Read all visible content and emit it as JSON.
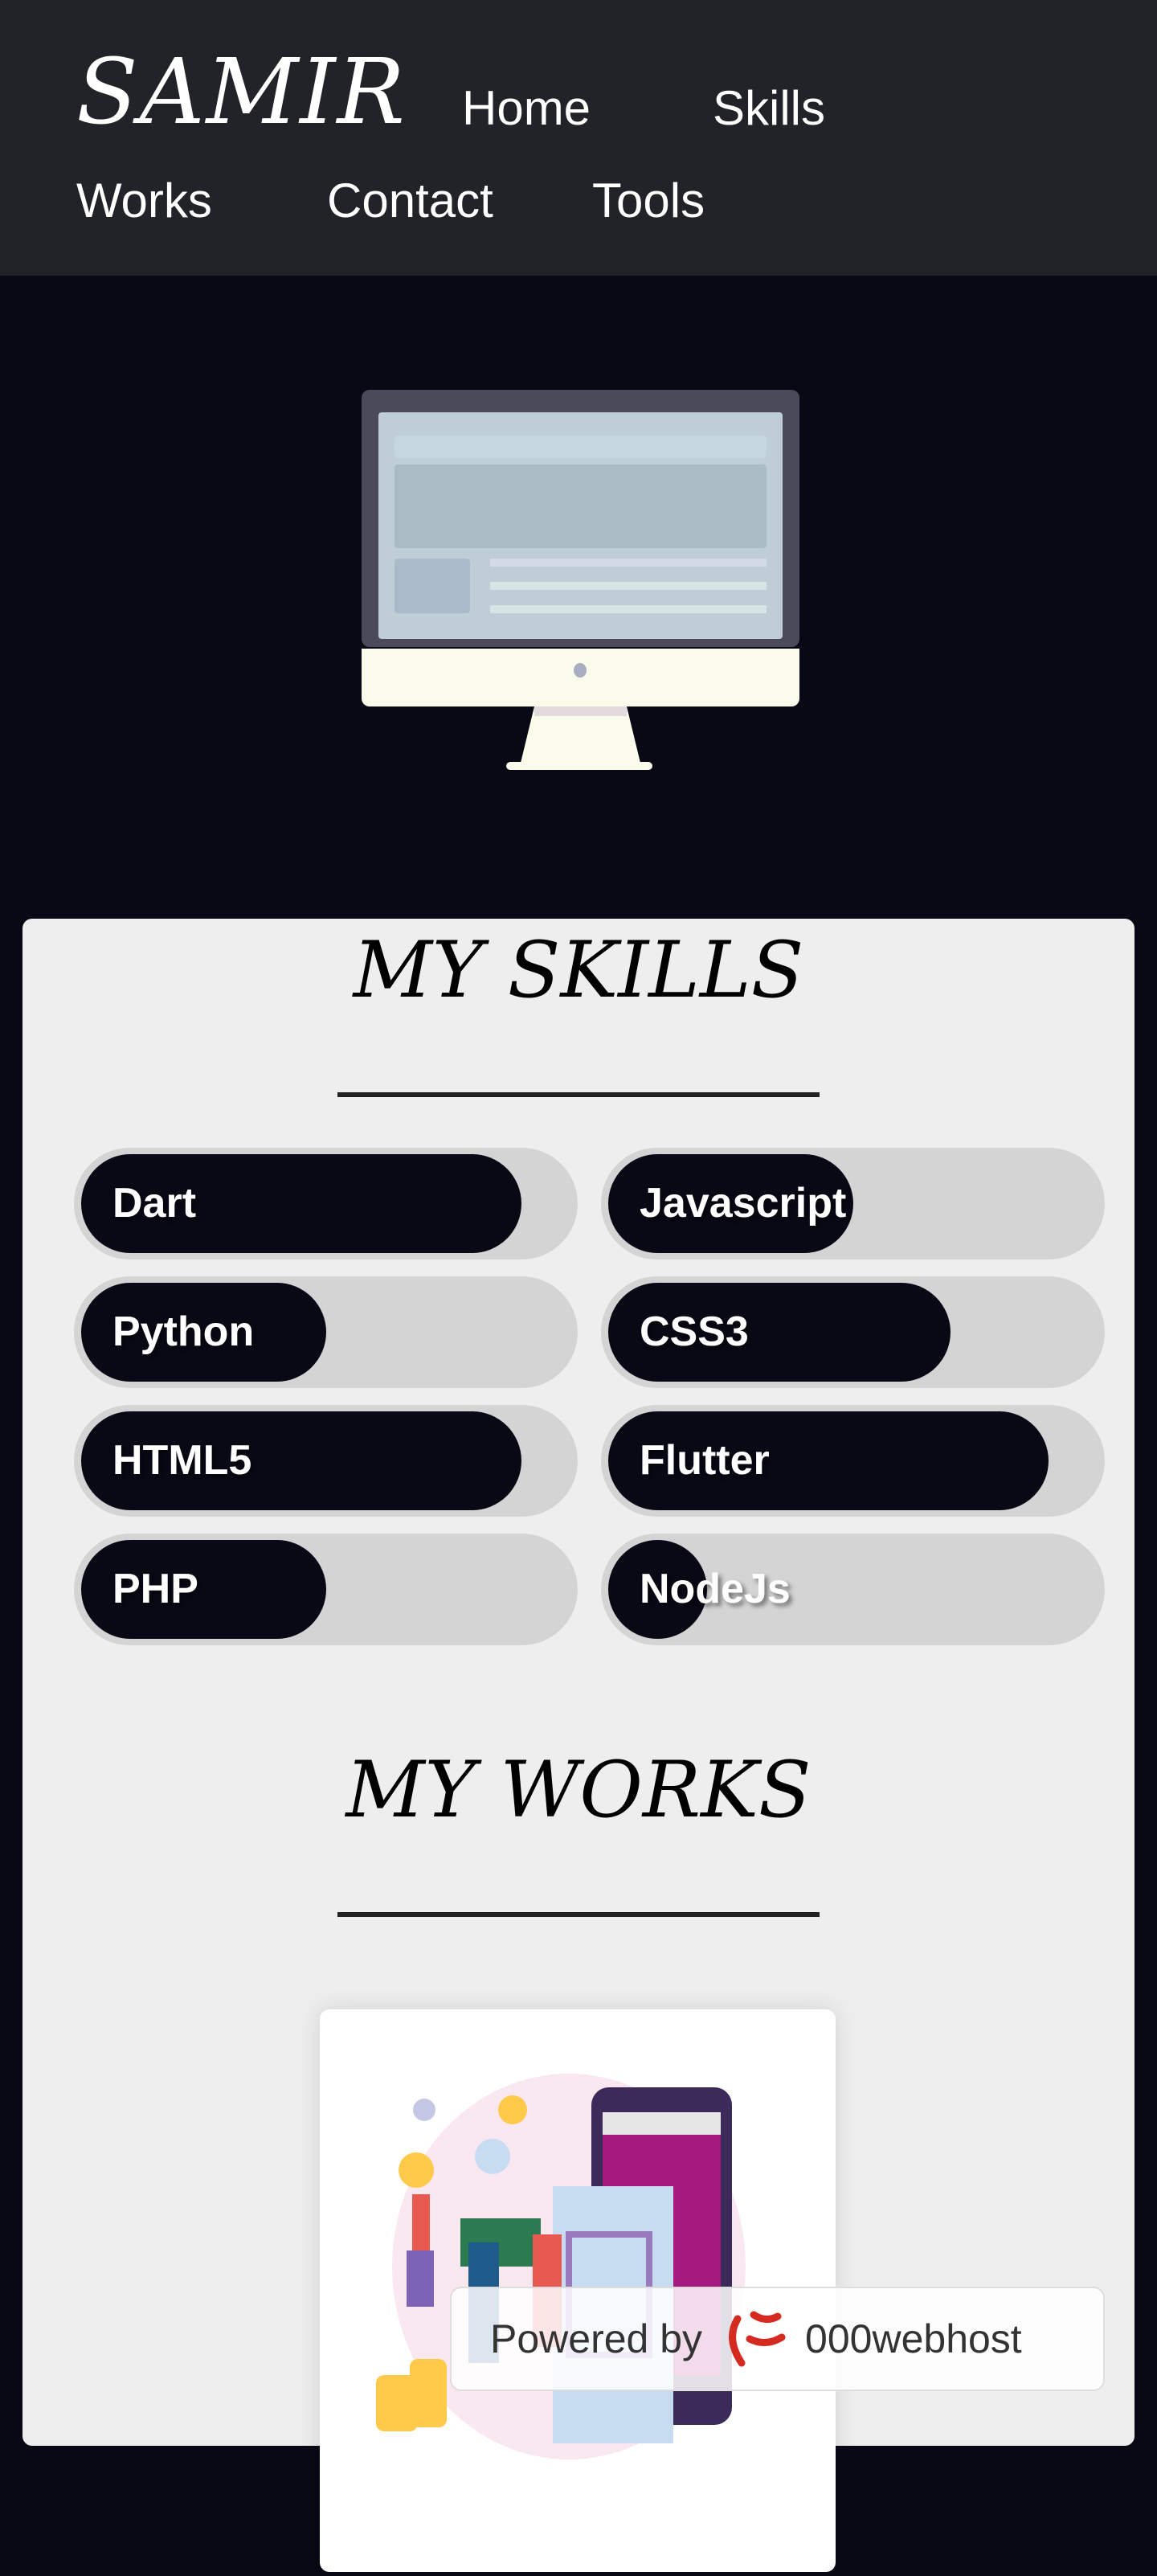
{
  "header": {
    "logo": "SAMIR",
    "nav": [
      {
        "label": "Home"
      },
      {
        "label": "Skills"
      },
      {
        "label": "Works"
      },
      {
        "label": "Contact"
      },
      {
        "label": "Tools"
      }
    ]
  },
  "skills": {
    "title": "MY SKILLS",
    "items": [
      {
        "label": "Dart",
        "percent": 90
      },
      {
        "label": "Javascript",
        "percent": 50
      },
      {
        "label": "Python",
        "percent": 50
      },
      {
        "label": "CSS3",
        "percent": 70
      },
      {
        "label": "HTML5",
        "percent": 90
      },
      {
        "label": "Flutter",
        "percent": 90
      },
      {
        "label": "PHP",
        "percent": 50
      },
      {
        "label": "NodeJs",
        "percent": 20
      }
    ]
  },
  "works": {
    "title": "MY WORKS"
  },
  "badge": {
    "powered": "Powered by",
    "brand": "000webhost"
  },
  "colors": {
    "header_bg": "#212329",
    "page_bg": "#090916",
    "card_bg": "#eeeeee",
    "track": "#d4d4d4"
  }
}
